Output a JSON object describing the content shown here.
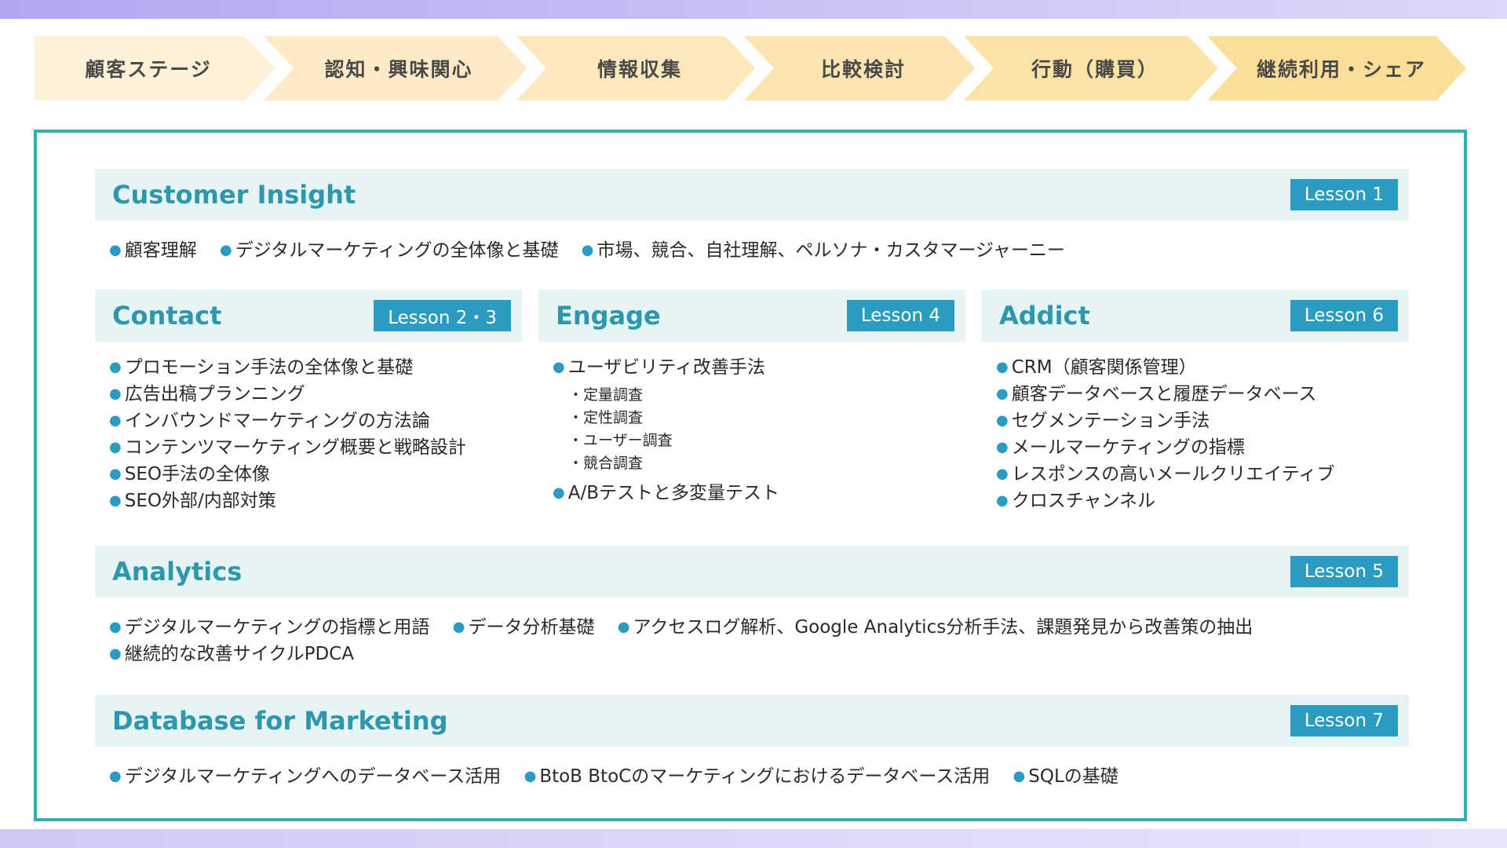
{
  "stages": [
    {
      "label": "顧客ステージ"
    },
    {
      "label": "認知・興味関心"
    },
    {
      "label": "情報収集"
    },
    {
      "label": "比較検討"
    },
    {
      "label": "行動（購買）"
    },
    {
      "label": "継続利用・シェア"
    }
  ],
  "colors": {
    "accent": "#2a9bc1",
    "title": "#2d97ae",
    "header_bg": "#e6f4f5",
    "border": "#3da8b8",
    "stage_light": "#fdf1d6",
    "stage_dark": "#fbdf92"
  },
  "sections": {
    "customer_insight": {
      "title": "Customer Insight",
      "lesson": "Lesson 1",
      "items": [
        "顧客理解",
        "デジタルマーケティングの全体像と基礎",
        "市場、競合、自社理解、ペルソナ・カスタマージャーニー"
      ]
    },
    "contact": {
      "title": "Contact",
      "lesson": "Lesson 2・3",
      "items": [
        "プロモーション手法の全体像と基礎",
        "広告出稿プランニング",
        "インバウンドマーケティングの方法論",
        "コンテンツマーケティング概要と戦略設計",
        "SEO手法の全体像",
        "SEO外部/内部対策"
      ]
    },
    "engage": {
      "title": "Engage",
      "lesson": "Lesson 4",
      "item1": "ユーザビリティ改善手法",
      "subitems": [
        "・定量調査",
        "・定性調査",
        "・ユーザー調査",
        "・競合調査"
      ],
      "item2": "A/Bテストと多変量テスト"
    },
    "addict": {
      "title": "Addict",
      "lesson": "Lesson 6",
      "items": [
        "CRM（顧客関係管理）",
        "顧客データベースと履歴データベース",
        "セグメンテーション手法",
        "メールマーケティングの指標",
        "レスポンスの高いメールクリエイティブ",
        "クロスチャンネル"
      ]
    },
    "analytics": {
      "title": "Analytics",
      "lesson": "Lesson 5",
      "row1": [
        "デジタルマーケティングの指標と用語",
        "データ分析基礎",
        "アクセスログ解析、Google Analytics分析手法、課題発見から改善策の抽出"
      ],
      "row2": [
        "継続的な改善サイクルPDCA"
      ]
    },
    "database": {
      "title": "Database for Marketing",
      "lesson": "Lesson 7",
      "items": [
        "デジタルマーケティングへのデータベース活用",
        "BtoB BtoCのマーケティングにおけるデータベース活用",
        "SQLの基礎"
      ]
    }
  }
}
